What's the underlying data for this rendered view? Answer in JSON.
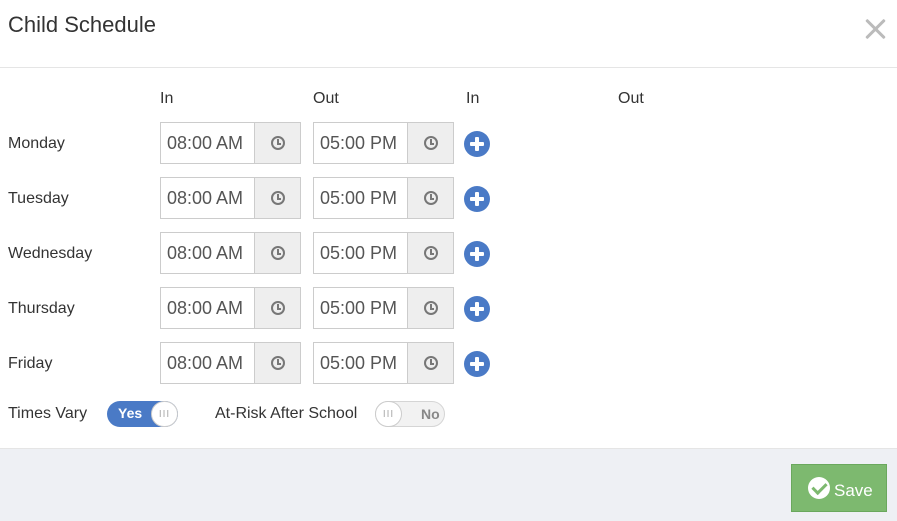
{
  "dialog": {
    "title": "Child Schedule"
  },
  "columns": {
    "in1": "In",
    "out1": "Out",
    "in2": "In",
    "out2": "Out"
  },
  "days": [
    {
      "label": "Monday",
      "in": "08:00 AM",
      "out": "05:00 PM"
    },
    {
      "label": "Tuesday",
      "in": "08:00 AM",
      "out": "05:00 PM"
    },
    {
      "label": "Wednesday",
      "in": "08:00 AM",
      "out": "05:00 PM"
    },
    {
      "label": "Thursday",
      "in": "08:00 AM",
      "out": "05:00 PM"
    },
    {
      "label": "Friday",
      "in": "08:00 AM",
      "out": "05:00 PM"
    }
  ],
  "toggles": {
    "times_vary": {
      "label": "Times Vary",
      "state": "Yes"
    },
    "at_risk": {
      "label": "At-Risk After School",
      "state": "No"
    }
  },
  "footer": {
    "save_label": "Save"
  },
  "colors": {
    "accent": "#4a7ac6",
    "save": "#7db96f"
  },
  "icons": {
    "close": "close-icon",
    "clock": "clock-icon",
    "add": "plus-circle-icon",
    "save": "check-circle-icon"
  }
}
